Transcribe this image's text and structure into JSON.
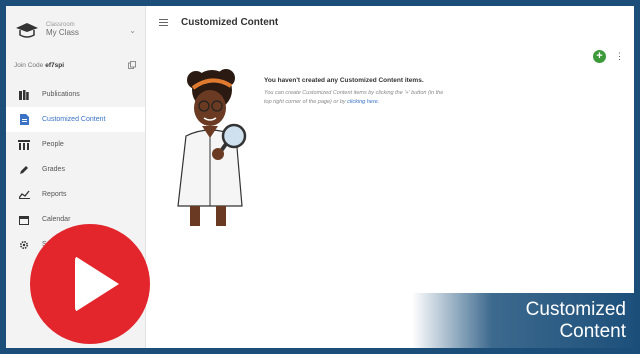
{
  "sidebar": {
    "class_label_small": "Classroom",
    "class_name": "My Class",
    "join_label": "Join Code",
    "join_code": "ef7spi",
    "items": [
      {
        "label": "Publications",
        "icon": "books-icon",
        "active": false
      },
      {
        "label": "Customized Content",
        "icon": "document-icon",
        "active": true
      },
      {
        "label": "People",
        "icon": "people-icon",
        "active": false
      },
      {
        "label": "Grades",
        "icon": "pencil-icon",
        "active": false
      },
      {
        "label": "Reports",
        "icon": "chart-icon",
        "active": false
      },
      {
        "label": "Calendar",
        "icon": "calendar-icon",
        "active": false
      },
      {
        "label": "Se",
        "icon": "gear-icon",
        "active": false
      }
    ]
  },
  "header": {
    "title": "Customized Content",
    "add_symbol": "+",
    "more_symbol": "⋮"
  },
  "empty_state": {
    "title": "You haven't created any Customized Content items.",
    "description": "You can create Customized Content items by clicking the '+' button (in the top right corner of the page) or by",
    "link": "clicking here."
  },
  "overlay": {
    "banner_line1": "Customized",
    "banner_line2": "Content"
  },
  "colors": {
    "accent": "#3a73c5",
    "add_button": "#3d9a3a",
    "play": "#e3252c",
    "banner": "#1b4f7a"
  }
}
